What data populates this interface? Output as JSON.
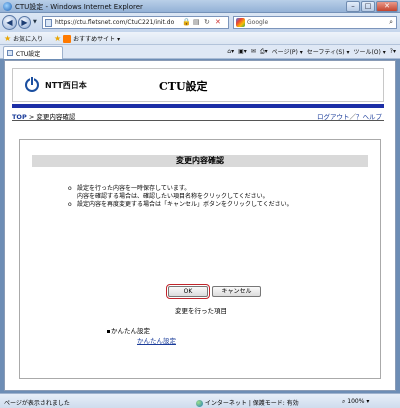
{
  "window": {
    "title": "CTU設定 - Windows Internet Explorer"
  },
  "address": {
    "url": "https://ctu.fletsnet.com/CtuC221/init.do",
    "search_placeholder": "Google"
  },
  "favorites": {
    "label": "お気に入り",
    "suggested": "おすすめサイト ▾"
  },
  "tab": {
    "title": "CTU設定"
  },
  "commands": {
    "page": "ページ(P) ▾",
    "safety": "セーフティ(S) ▾",
    "tools": "ツール(O) ▾"
  },
  "header": {
    "brand": "NTT西日本",
    "app_title": "CTU設定"
  },
  "breadcrumb": {
    "top": "TOP",
    "sep": ">",
    "current": "変更内容確認"
  },
  "header_links": {
    "logout": "ログアウト",
    "sep": "／",
    "help": "？ヘルプ"
  },
  "panel": {
    "title": "変更内容確認",
    "note1_line1": "設定を行った内容を一時保存しています。",
    "note1_line2": "内容を確認する場合は、確認したい項目名称をクリックしてください。",
    "note2": "設定内容を再度変更する場合は「キャンセル」ボタンをクリックしてください。",
    "ok_label": "OK",
    "cancel_label": "キャンセル",
    "changed_heading": "変更を行った項目",
    "item_label": "かんたん設定",
    "item_link": "かんたん設定"
  },
  "status": {
    "left": "ページが表示されました",
    "zone": "インターネット | 保護モード: 有効",
    "zoom": "100%"
  }
}
